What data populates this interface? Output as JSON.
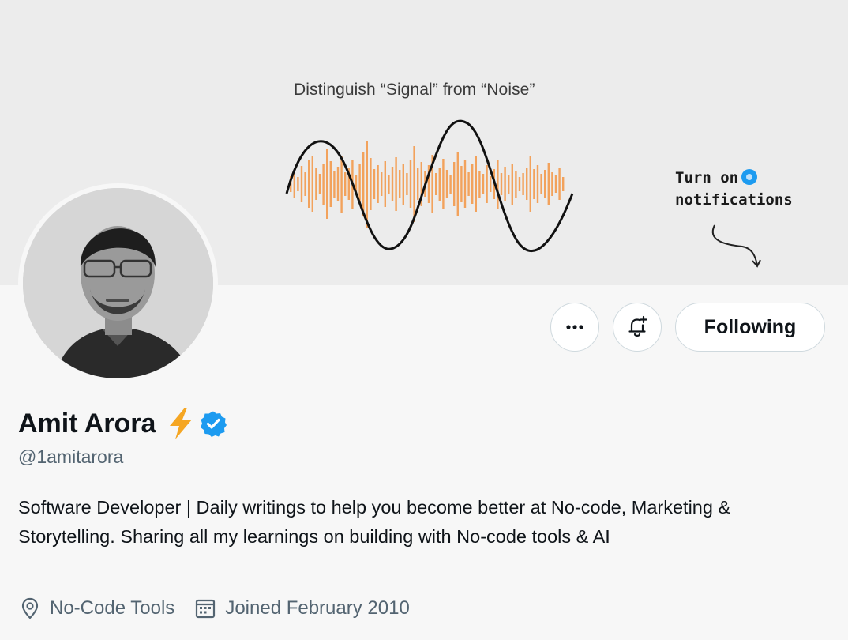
{
  "banner": {
    "title": "Distinguish “Signal” from “Noise”",
    "notify_line1": "Turn on",
    "notify_line2": "notifications"
  },
  "actions": {
    "more_icon": "more-horizontal-icon",
    "bell_icon": "bell-plus-icon",
    "following_label": "Following"
  },
  "profile": {
    "name": "Amit Arora",
    "name_emoji_icon": "lightning-bolt-icon",
    "verified_icon": "verified-badge-icon",
    "handle": "@1amitarora",
    "bio": "Software Developer | Daily writings to help you become better at No-code, Marketing & Storytelling. Sharing all my learnings on building with No-code tools & AI",
    "location": "No-Code Tools",
    "joined": "Joined February 2010"
  },
  "colors": {
    "accent": "#1d9bf0",
    "wave_orange": "#f2a25c",
    "bolt": "#f5a623"
  }
}
